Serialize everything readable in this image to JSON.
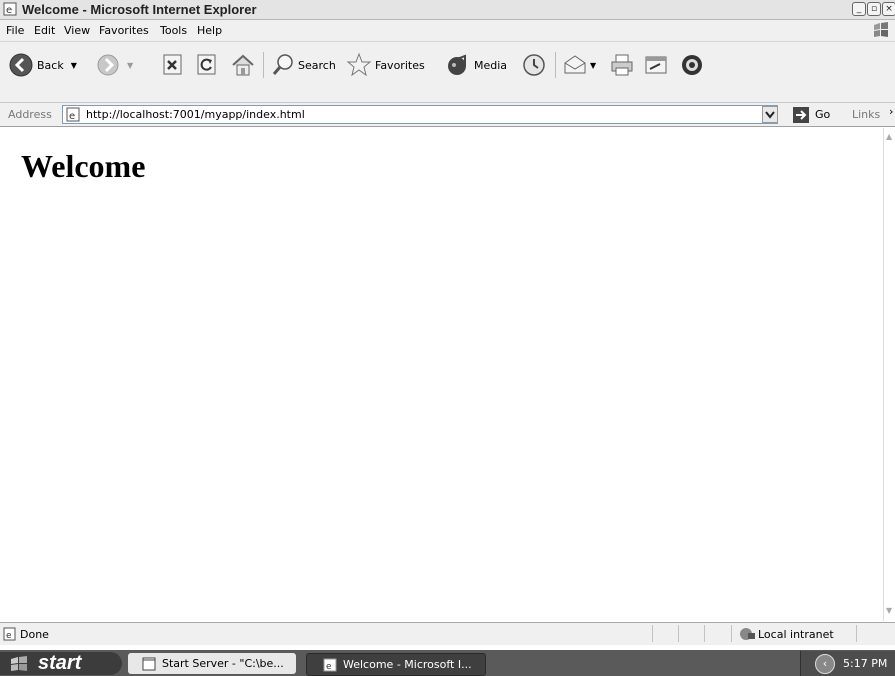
{
  "window": {
    "title": "Welcome - Microsoft Internet Explorer"
  },
  "menu": [
    "File",
    "Edit",
    "View",
    "Favorites",
    "Tools",
    "Help"
  ],
  "toolbar": {
    "back_label": "Back",
    "search_label": "Search",
    "favorites_label": "Favorites",
    "media_label": "Media"
  },
  "address": {
    "label": "Address",
    "url": "http://localhost:7001/myapp/index.html",
    "go_label": "Go",
    "links_label": "Links"
  },
  "page": {
    "heading": "Welcome"
  },
  "status": {
    "text": "Done",
    "zone": "Local intranet"
  },
  "taskbar": {
    "start_label": "start",
    "items": [
      {
        "label": "Start Server - \"C:\\be..."
      },
      {
        "label": "Welcome - Microsoft I..."
      }
    ],
    "clock": "5:17 PM"
  }
}
